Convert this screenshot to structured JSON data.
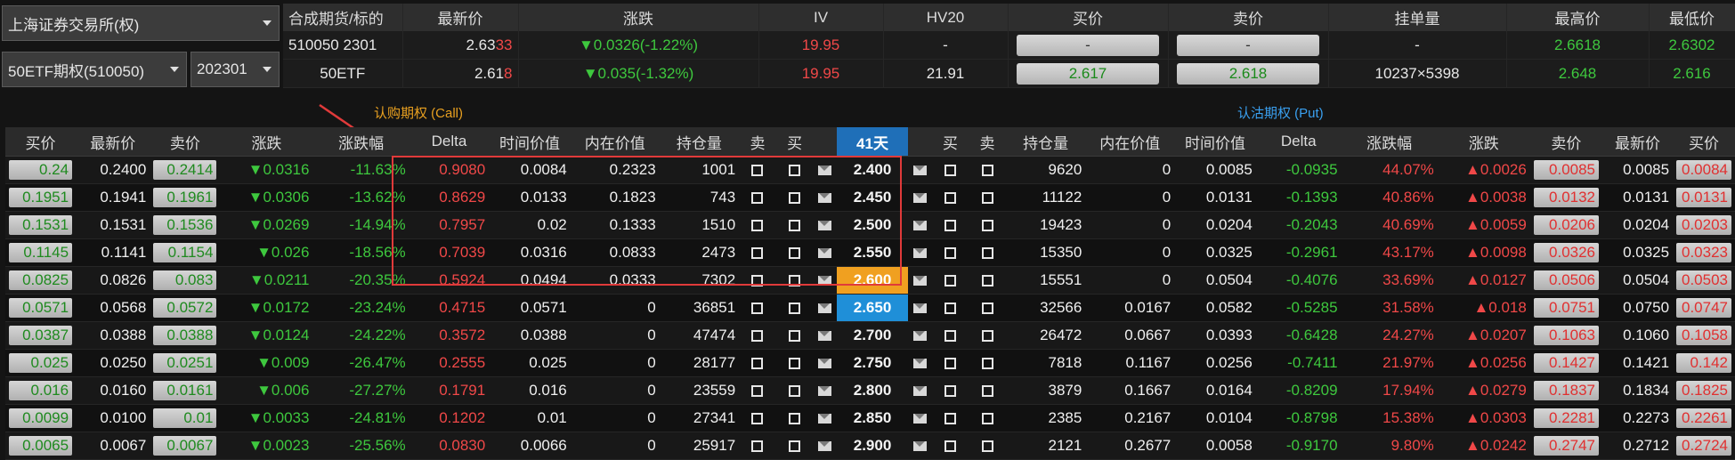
{
  "left_panel": {
    "exchange": "上海证券交易所(权)",
    "product": "50ETF期权(510050)",
    "month": "202301"
  },
  "quote_header": [
    "合成期货/标的",
    "最新价",
    "涨跌",
    "IV",
    "HV20",
    "买价",
    "卖价",
    "挂单量",
    "最高价",
    "最低价"
  ],
  "quote_rows": [
    {
      "name": "510050 2301",
      "last_main": "2.63",
      "last_tail": "33",
      "change": "▼0.0326(-1.22%)",
      "iv": "19.95",
      "hv20": "-",
      "bid": "-",
      "ask": "-",
      "depth": "-",
      "high": "2.6618",
      "low": "2.6302"
    },
    {
      "name": "50ETF",
      "last_main": "2.61",
      "last_tail": "8",
      "change": "▼0.035(-1.32%)",
      "iv": "19.95",
      "hv20": "21.91",
      "bid": "2.617",
      "ask": "2.618",
      "depth": "10237×5398",
      "high": "2.648",
      "low": "2.616"
    }
  ],
  "call_label": "认购期权 (Call)",
  "put_label": "认沽期权 (Put)",
  "chain_header": {
    "call": [
      "买价",
      "最新价",
      "卖价",
      "涨跌",
      "涨跌幅",
      "Delta",
      "时间价值",
      "内在价值",
      "持仓量",
      "卖",
      "买"
    ],
    "days": "41天",
    "put": [
      "买",
      "卖",
      "持仓量",
      "内在价值",
      "时间价值",
      "Delta",
      "涨跌幅",
      "涨跌",
      "卖价",
      "最新价",
      "买价"
    ]
  },
  "rows": [
    {
      "c_bid": "0.24",
      "c_last": "0.2400",
      "c_ask": "0.2414",
      "c_chg": "▼0.0316",
      "c_pct": "-11.63%",
      "c_delta": "0.9080",
      "c_tv": "0.0084",
      "c_iv": "0.2323",
      "c_oi": "1001",
      "strike": "2.400",
      "p_oi": "9620",
      "p_iv": "0",
      "p_tv": "0.0085",
      "p_delta": "-0.0935",
      "p_pct": "44.07%",
      "p_chg": "▲0.0026",
      "p_ask": "0.0085",
      "p_last": "0.0085",
      "p_bid": "0.0084"
    },
    {
      "c_bid": "0.1951",
      "c_last": "0.1941",
      "c_ask": "0.1961",
      "c_chg": "▼0.0306",
      "c_pct": "-13.62%",
      "c_delta": "0.8629",
      "c_tv": "0.0133",
      "c_iv": "0.1823",
      "c_oi": "743",
      "strike": "2.450",
      "p_oi": "11122",
      "p_iv": "0",
      "p_tv": "0.0131",
      "p_delta": "-0.1393",
      "p_pct": "40.86%",
      "p_chg": "▲0.0038",
      "p_ask": "0.0132",
      "p_last": "0.0131",
      "p_bid": "0.0131"
    },
    {
      "c_bid": "0.1531",
      "c_last": "0.1531",
      "c_ask": "0.1536",
      "c_chg": "▼0.0269",
      "c_pct": "-14.94%",
      "c_delta": "0.7957",
      "c_tv": "0.02",
      "c_iv": "0.1333",
      "c_oi": "1510",
      "strike": "2.500",
      "p_oi": "19423",
      "p_iv": "0",
      "p_tv": "0.0204",
      "p_delta": "-0.2043",
      "p_pct": "40.69%",
      "p_chg": "▲0.0059",
      "p_ask": "0.0206",
      "p_last": "0.0204",
      "p_bid": "0.0203"
    },
    {
      "c_bid": "0.1145",
      "c_last": "0.1141",
      "c_ask": "0.1154",
      "c_chg": "▼0.026",
      "c_pct": "-18.56%",
      "c_delta": "0.7039",
      "c_tv": "0.0316",
      "c_iv": "0.0833",
      "c_oi": "2473",
      "strike": "2.550",
      "p_oi": "15350",
      "p_iv": "0",
      "p_tv": "0.0325",
      "p_delta": "-0.2961",
      "p_pct": "43.17%",
      "p_chg": "▲0.0098",
      "p_ask": "0.0326",
      "p_last": "0.0325",
      "p_bid": "0.0323"
    },
    {
      "c_bid": "0.0825",
      "c_last": "0.0826",
      "c_ask": "0.083",
      "c_chg": "▼0.0211",
      "c_pct": "-20.35%",
      "c_delta": "0.5924",
      "c_tv": "0.0494",
      "c_iv": "0.0333",
      "c_oi": "7302",
      "strike": "2.600",
      "p_oi": "15551",
      "p_iv": "0",
      "p_tv": "0.0504",
      "p_delta": "-0.4076",
      "p_pct": "33.69%",
      "p_chg": "▲0.0127",
      "p_ask": "0.0506",
      "p_last": "0.0504",
      "p_bid": "0.0503"
    },
    {
      "c_bid": "0.0571",
      "c_last": "0.0568",
      "c_ask": "0.0572",
      "c_chg": "▼0.0172",
      "c_pct": "-23.24%",
      "c_delta": "0.4715",
      "c_tv": "0.0571",
      "c_iv": "0",
      "c_oi": "36851",
      "strike": "2.650",
      "p_oi": "32566",
      "p_iv": "0.0167",
      "p_tv": "0.0582",
      "p_delta": "-0.5285",
      "p_pct": "31.58%",
      "p_chg": "▲0.018",
      "p_ask": "0.0751",
      "p_last": "0.0750",
      "p_bid": "0.0747"
    },
    {
      "c_bid": "0.0387",
      "c_last": "0.0388",
      "c_ask": "0.0388",
      "c_chg": "▼0.0124",
      "c_pct": "-24.22%",
      "c_delta": "0.3572",
      "c_tv": "0.0388",
      "c_iv": "0",
      "c_oi": "47474",
      "strike": "2.700",
      "p_oi": "26472",
      "p_iv": "0.0667",
      "p_tv": "0.0393",
      "p_delta": "-0.6428",
      "p_pct": "24.27%",
      "p_chg": "▲0.0207",
      "p_ask": "0.1063",
      "p_last": "0.1060",
      "p_bid": "0.1058"
    },
    {
      "c_bid": "0.025",
      "c_last": "0.0250",
      "c_ask": "0.0251",
      "c_chg": "▼0.009",
      "c_pct": "-26.47%",
      "c_delta": "0.2555",
      "c_tv": "0.025",
      "c_iv": "0",
      "c_oi": "28177",
      "strike": "2.750",
      "p_oi": "7818",
      "p_iv": "0.1167",
      "p_tv": "0.0256",
      "p_delta": "-0.7411",
      "p_pct": "21.97%",
      "p_chg": "▲0.0256",
      "p_ask": "0.1427",
      "p_last": "0.1421",
      "p_bid": "0.142"
    },
    {
      "c_bid": "0.016",
      "c_last": "0.0160",
      "c_ask": "0.0161",
      "c_chg": "▼0.006",
      "c_pct": "-27.27%",
      "c_delta": "0.1791",
      "c_tv": "0.016",
      "c_iv": "0",
      "c_oi": "23559",
      "strike": "2.800",
      "p_oi": "3879",
      "p_iv": "0.1667",
      "p_tv": "0.0164",
      "p_delta": "-0.8209",
      "p_pct": "17.94%",
      "p_chg": "▲0.0279",
      "p_ask": "0.1837",
      "p_last": "0.1834",
      "p_bid": "0.1825"
    },
    {
      "c_bid": "0.0099",
      "c_last": "0.0100",
      "c_ask": "0.01",
      "c_chg": "▼0.0033",
      "c_pct": "-24.81%",
      "c_delta": "0.1202",
      "c_tv": "0.01",
      "c_iv": "0",
      "c_oi": "27341",
      "strike": "2.850",
      "p_oi": "2385",
      "p_iv": "0.2167",
      "p_tv": "0.0104",
      "p_delta": "-0.8798",
      "p_pct": "15.38%",
      "p_chg": "▲0.0303",
      "p_ask": "0.2281",
      "p_last": "0.2273",
      "p_bid": "0.2261"
    },
    {
      "c_bid": "0.0065",
      "c_last": "0.0067",
      "c_ask": "0.0067",
      "c_chg": "▼0.0023",
      "c_pct": "-25.56%",
      "c_delta": "0.0830",
      "c_tv": "0.0066",
      "c_iv": "0",
      "c_oi": "25917",
      "strike": "2.900",
      "p_oi": "2121",
      "p_iv": "0.2677",
      "p_tv": "0.0058",
      "p_delta": "-0.9170",
      "p_pct": "9.80%",
      "p_chg": "▲0.0242",
      "p_ask": "0.2747",
      "p_last": "0.2712",
      "p_bid": "0.2724"
    }
  ],
  "colors": {
    "up": "#f04848",
    "down": "#3ec83e",
    "atm_highlight": "#f0a020",
    "selected_strike": "#1f8fd8",
    "annotation": "#e03a3a",
    "call_label": "#e8a020",
    "put_label": "#3aa0f0"
  }
}
